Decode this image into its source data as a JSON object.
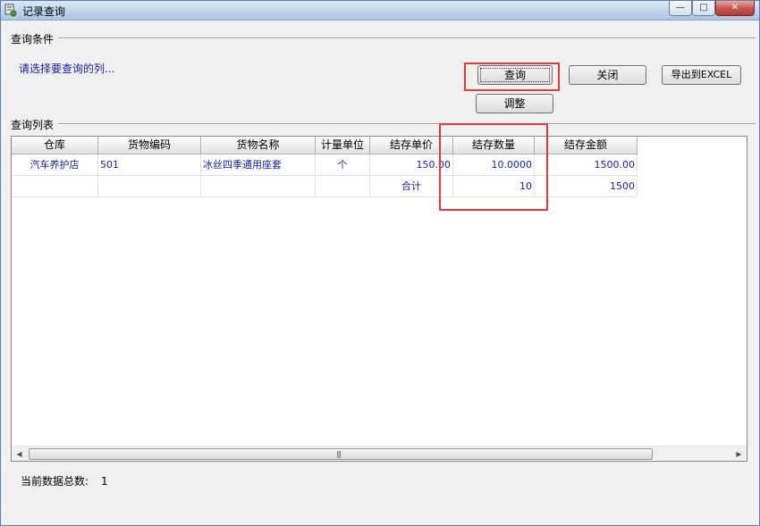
{
  "window": {
    "title": "记录查询",
    "controls": {
      "minimize": "—",
      "maximize": "□",
      "close": "✕"
    }
  },
  "criteria": {
    "group_label": "查询条件",
    "hint": "请选择要查询的列...",
    "buttons": {
      "query": "查询",
      "close": "关闭",
      "export": "导出到EXCEL",
      "adjust": "调整"
    }
  },
  "results": {
    "group_label": "查询列表",
    "columns": [
      "仓库",
      "货物编码",
      "货物名称",
      "计量单位",
      "结存单价",
      "结存数量",
      "结存金额"
    ],
    "rows": [
      [
        "汽车养护店",
        "501",
        "冰丝四季通用座套",
        "个",
        "150.00",
        "10.0000",
        "1500.00"
      ],
      [
        "",
        "",
        "",
        "",
        "合计",
        "10",
        "1500"
      ]
    ]
  },
  "footer": {
    "label": "当前数据总数:",
    "count": "1"
  },
  "colors": {
    "data_text": "#1a1aa6",
    "annotation_red": "#e53935"
  },
  "icons": [
    "app-icon",
    "minimize-icon",
    "maximize-icon",
    "close-icon",
    "scroll-left-icon",
    "scroll-right-icon"
  ]
}
